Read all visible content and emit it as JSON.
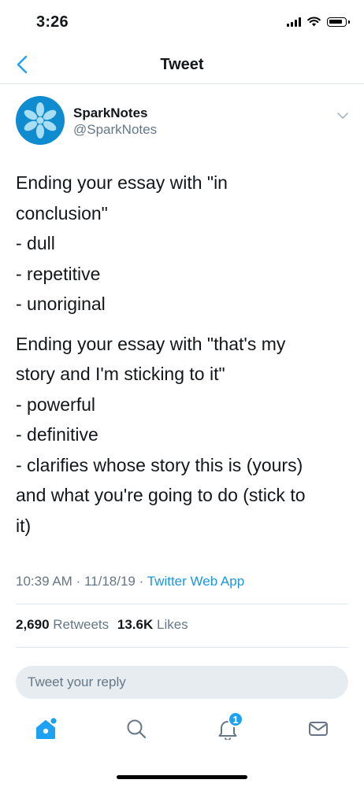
{
  "status_bar": {
    "time": "3:26"
  },
  "nav": {
    "title": "Tweet"
  },
  "tweet": {
    "author_name": "SparkNotes",
    "author_handle": "@SparkNotes",
    "paragraphs": [
      [
        "Ending your essay with \"in",
        "conclusion\"",
        "- dull",
        "- repetitive",
        "- unoriginal"
      ],
      [
        "Ending your essay with \"that's my",
        "story and I'm sticking to it\"",
        "- powerful",
        "- definitive",
        "- clarifies whose story this is (yours)",
        "and what you're going to do (stick to",
        "it)"
      ]
    ],
    "time": "10:39 AM",
    "date": "11/18/19",
    "separator": "·",
    "source": "Twitter Web App",
    "retweets_count": "2,690",
    "retweets_label": "Retweets",
    "likes_count": "13.6K",
    "likes_label": "Likes"
  },
  "reply": {
    "placeholder": "Tweet your reply"
  },
  "tab_bar": {
    "items": [
      {
        "icon": "home-icon",
        "active": true
      },
      {
        "icon": "search-icon",
        "active": false
      },
      {
        "icon": "bell-icon",
        "active": false,
        "badge": "1"
      },
      {
        "icon": "mail-icon",
        "active": false
      }
    ]
  },
  "colors": {
    "accent": "#1da1f2",
    "link": "#1b95e0",
    "secondary_text": "#657786",
    "divider": "#e1e8ed",
    "avatar_bg": "#0f8bcf"
  }
}
